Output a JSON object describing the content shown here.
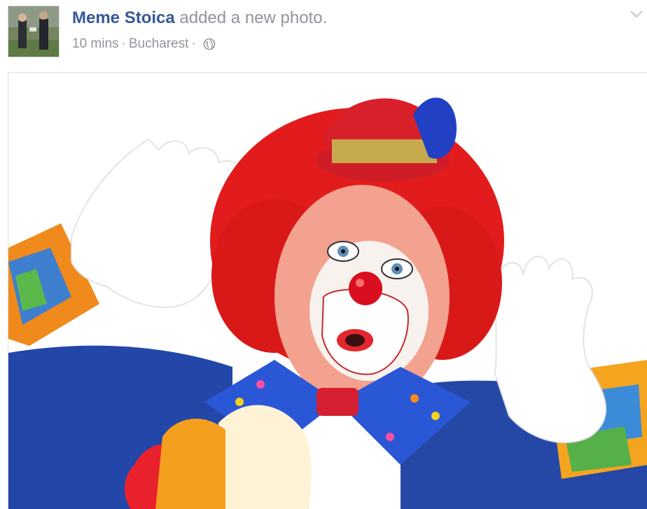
{
  "post": {
    "author": "Meme Stoica",
    "action": "added a new photo.",
    "time": "10 mins",
    "separator": "·",
    "location": "Bucharest"
  },
  "icons": {
    "privacy": "globe-icon",
    "menu": "chevron-down-icon"
  },
  "colors": {
    "author_link": "#365899",
    "meta_text": "#90949c"
  }
}
